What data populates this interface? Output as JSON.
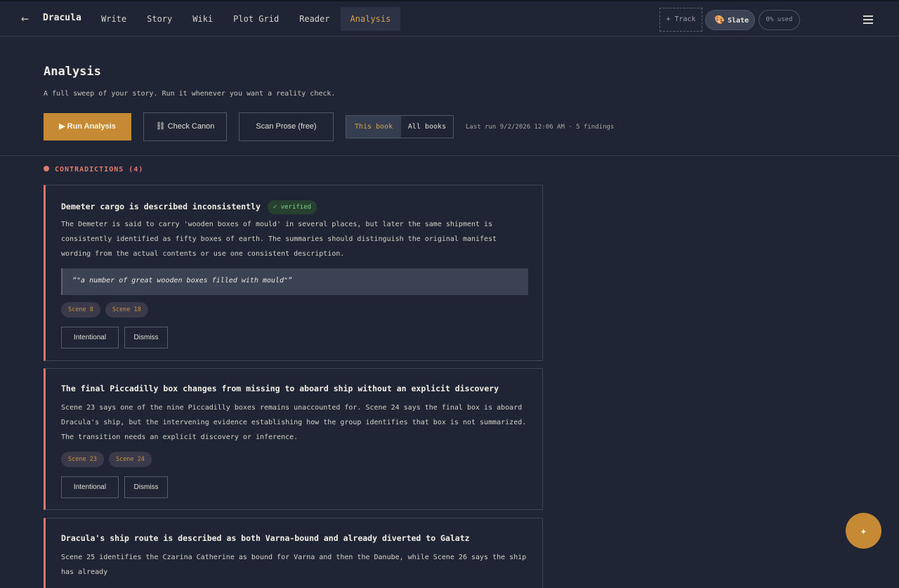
{
  "header": {
    "back_icon": "←",
    "book_title": "Dracula",
    "tabs": [
      {
        "label": "Write"
      },
      {
        "label": "Story"
      },
      {
        "label": "Wiki"
      },
      {
        "label": "Plot Grid"
      },
      {
        "label": "Reader"
      },
      {
        "label": "Analysis"
      }
    ],
    "active_tab": "Analysis",
    "track_label": "+ Track",
    "theme_label": "Slate",
    "theme_icon": "palette-icon",
    "usage_label": "0% used",
    "menu_icon": "hamburger-icon"
  },
  "page": {
    "title": "Analysis",
    "subtitle": "A full sweep of your story. Run it whenever you want a reality check.",
    "run_label": "▶ Run Analysis",
    "canon_label": "⛓ Check Canon",
    "scan_label": "Scan Prose (free)",
    "scope_options": [
      "This book",
      "All books"
    ],
    "scope_selected": "This book",
    "last_run": "Last run 9/2/2026 12:06 AM · 5 findings"
  },
  "section": {
    "title": "CONTRADICTIONS (4)",
    "color": "#e07a6e"
  },
  "findings": [
    {
      "title": "Demeter cargo is described inconsistently",
      "badge": "✓ verified",
      "body": "The Demeter is said to carry 'wooden boxes of mould' in several places, but later the same shipment is consistently identified as fifty boxes of earth. The summaries should distinguish the original manifest wording from the actual contents or use one consistent description.",
      "quote": "“\"a number of great wooden boxes filled with mould\"”",
      "scenes": [
        "Scene 8",
        "Scene 18"
      ],
      "action_intentional": "Intentional",
      "action_dismiss": "Dismiss"
    },
    {
      "title": "The final Piccadilly box changes from missing to aboard ship without an explicit discovery",
      "body": "Scene 23 says one of the nine Piccadilly boxes remains unaccounted for. Scene 24 says the final box is aboard Dracula's ship, but the intervening evidence establishing how the group identifies that box is not summarized. The transition needs an explicit discovery or inference.",
      "scenes": [
        "Scene 23",
        "Scene 24"
      ],
      "action_intentional": "Intentional",
      "action_dismiss": "Dismiss"
    },
    {
      "title": "Dracula's ship route is described as both Varna-bound and already diverted to Galatz",
      "body": "Scene 25 identifies the Czarina Catherine as bound for Varna and then the Danube, while Scene 26 says the ship has already"
    }
  ],
  "fab_icon": "✦",
  "colors": {
    "accent": "#c58a33",
    "background": "#1f2534",
    "contradiction": "#d9786c",
    "verified": "#7fd08a"
  }
}
